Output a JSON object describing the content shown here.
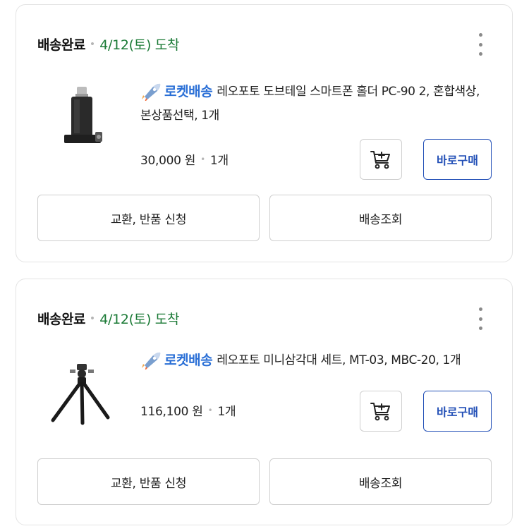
{
  "orders": [
    {
      "status": "배송완료",
      "arrival": "4/12(토) 도착",
      "badge": "로켓배송",
      "title": "레오포토 도브테일 스마트폰 홀더 PC-90 2, 혼합색상, 본상품선택, 1개",
      "price": "30,000 원",
      "quantity": "1개",
      "buy_label": "바로구매",
      "return_label": "교환, 반품 신청",
      "track_label": "배송조회"
    },
    {
      "status": "배송완료",
      "arrival": "4/12(토) 도착",
      "badge": "로켓배송",
      "title": "레오포토 미니삼각대 세트, MT-03, MBC-20, 1개",
      "price": "116,100 원",
      "quantity": "1개",
      "buy_label": "바로구매",
      "return_label": "교환, 반품 신청",
      "track_label": "배송조회"
    }
  ],
  "colors": {
    "arrival": "#1b7a36",
    "rocket": "#2a6fd6",
    "buy": "#2350b7"
  },
  "icons": {
    "more": "kebab-menu-icon",
    "rocket": "rocket-icon",
    "cart": "add-to-cart-icon"
  }
}
